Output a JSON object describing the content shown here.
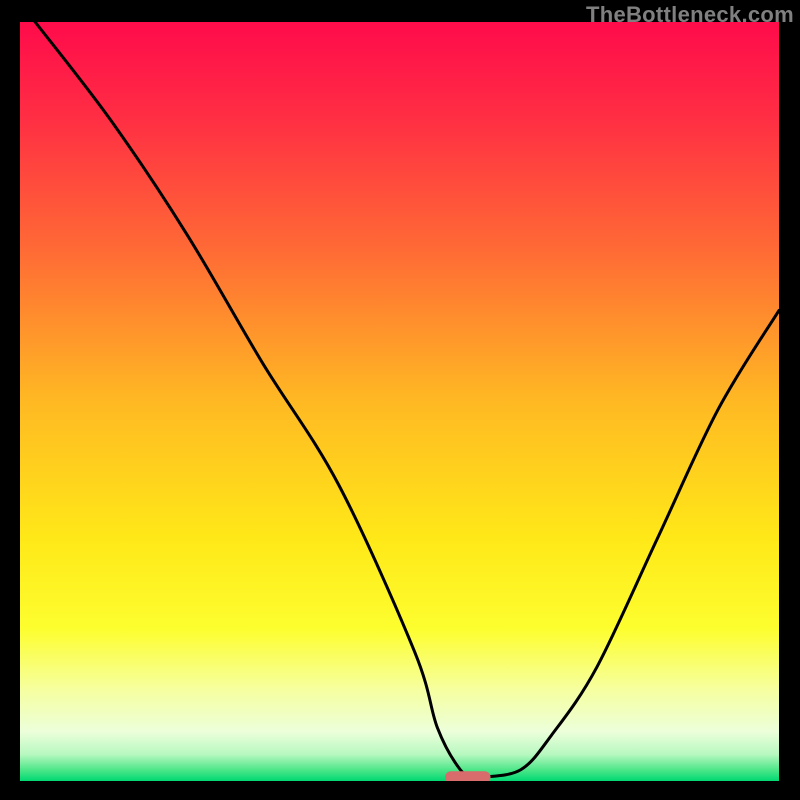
{
  "watermark": "TheBottleneck.com",
  "chart_data": {
    "type": "line",
    "title": "",
    "xlabel": "",
    "ylabel": "",
    "xlim": [
      0,
      100
    ],
    "ylim": [
      0,
      100
    ],
    "series": [
      {
        "name": "bottleneck-curve",
        "x": [
          2,
          12,
          22,
          32,
          42,
          52,
          55,
          58,
          60,
          61,
          66,
          70,
          76,
          84,
          92,
          100
        ],
        "values": [
          100,
          87,
          72,
          55,
          39,
          17,
          7,
          1.5,
          0.5,
          0.5,
          1.5,
          6,
          15,
          32,
          49,
          62
        ]
      }
    ],
    "marker": {
      "name": "optimal-range",
      "x_start": 56,
      "x_end": 62,
      "y": 0.5,
      "color": "#d86b6b"
    },
    "gradient_stops": [
      {
        "pos": 0.0,
        "color": "#ff0b4b"
      },
      {
        "pos": 0.12,
        "color": "#ff2c44"
      },
      {
        "pos": 0.3,
        "color": "#ff6a35"
      },
      {
        "pos": 0.5,
        "color": "#ffb923"
      },
      {
        "pos": 0.68,
        "color": "#ffe818"
      },
      {
        "pos": 0.8,
        "color": "#fdfe2f"
      },
      {
        "pos": 0.88,
        "color": "#f6ffa0"
      },
      {
        "pos": 0.935,
        "color": "#ecffda"
      },
      {
        "pos": 0.965,
        "color": "#b7f8c0"
      },
      {
        "pos": 0.985,
        "color": "#4fe78a"
      },
      {
        "pos": 1.0,
        "color": "#00d872"
      }
    ]
  }
}
